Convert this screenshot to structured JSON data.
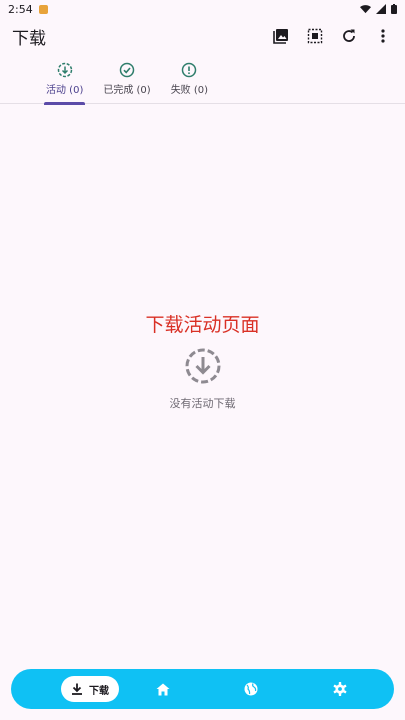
{
  "status_bar": {
    "time": "2:54"
  },
  "app_bar": {
    "title": "下载"
  },
  "tabs": [
    {
      "label": "活动 (0)",
      "icon": "download-progress-icon",
      "active": true
    },
    {
      "label": "已完成 (0)",
      "icon": "check-circle-icon",
      "active": false
    },
    {
      "label": "失败 (0)",
      "icon": "error-circle-icon",
      "active": false
    }
  ],
  "empty_state": {
    "title": "下载活动页面",
    "message": "没有活动下载"
  },
  "bottom_nav": {
    "download_label": "下载"
  },
  "colors": {
    "background": "#fdf7fc",
    "accent": "#5b4ba8",
    "tab_icon": "#2e7d6b",
    "title_red": "#d93025",
    "nav_bar": "#0fc1f4"
  }
}
